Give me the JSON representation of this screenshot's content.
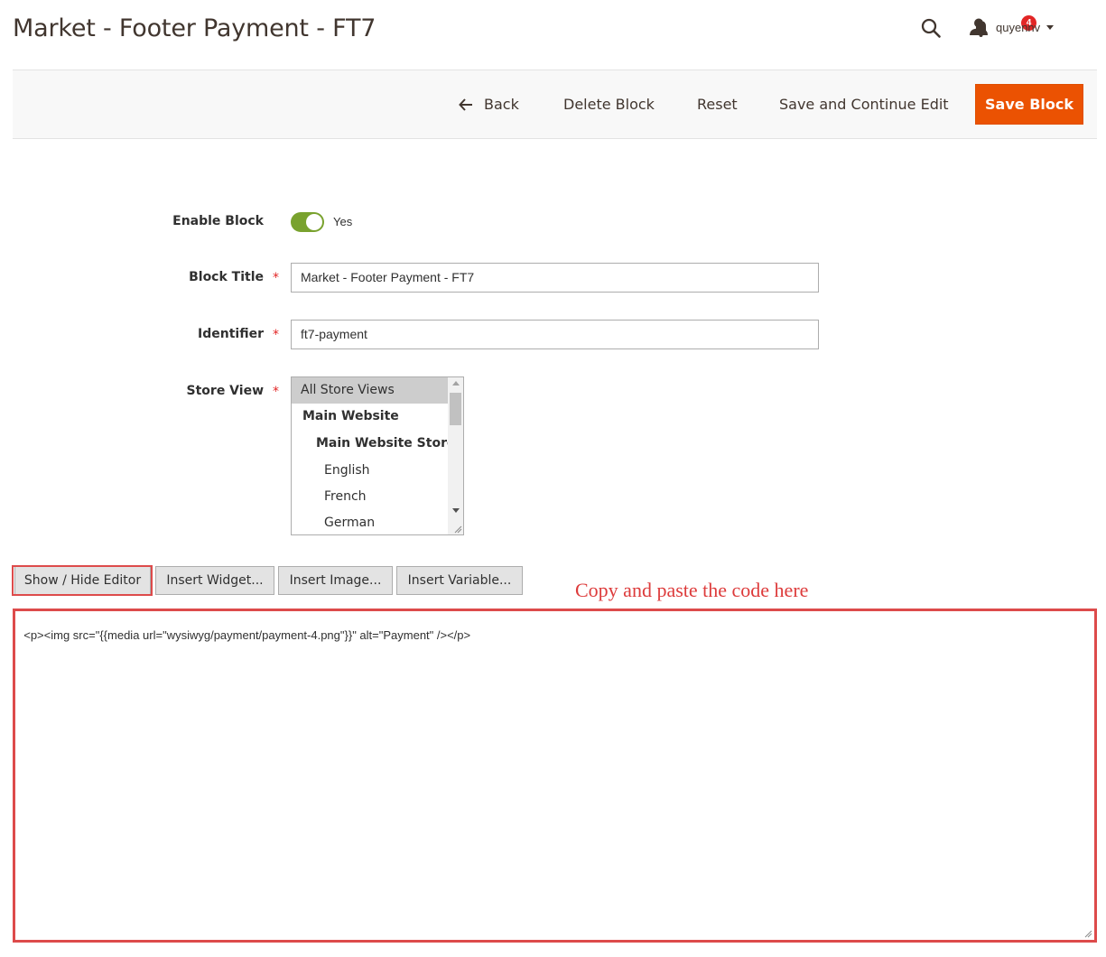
{
  "page": {
    "title": "Market - Footer Payment - FT7"
  },
  "header": {
    "notification_count": "4",
    "username": "quyennv",
    "icons": [
      "search-icon",
      "bell-icon",
      "user-icon",
      "chevron-down-icon"
    ]
  },
  "actions": {
    "back": "Back",
    "delete": "Delete Block",
    "reset": "Reset",
    "save_continue": "Save and Continue Edit",
    "save": "Save Block",
    "accent_color": "#eb5202"
  },
  "form": {
    "enable_block": {
      "label": "Enable Block",
      "value": "Yes",
      "on": true
    },
    "block_title": {
      "label": "Block Title",
      "value": "Market - Footer Payment - FT7",
      "required": true
    },
    "identifier": {
      "label": "Identifier",
      "value": "ft7-payment",
      "required": true
    },
    "store_view": {
      "label": "Store View",
      "required": true,
      "options": [
        {
          "label": "All Store Views",
          "selected": true
        },
        {
          "label": "Main Website"
        },
        {
          "label": "Main Website Store"
        },
        {
          "label": "English"
        },
        {
          "label": "French"
        },
        {
          "label": "German"
        }
      ]
    }
  },
  "editor": {
    "buttons": {
      "show_hide": "Show / Hide Editor",
      "insert_widget": "Insert Widget...",
      "insert_image": "Insert Image...",
      "insert_variable": "Insert Variable..."
    },
    "annotation": "Copy and paste the code here",
    "content": "<p><img src=\"{{media url=\"wysiwyg/payment/payment-4.png\"}}\" alt=\"Payment\" /></p>",
    "highlight_color": "#dd4b4b"
  }
}
